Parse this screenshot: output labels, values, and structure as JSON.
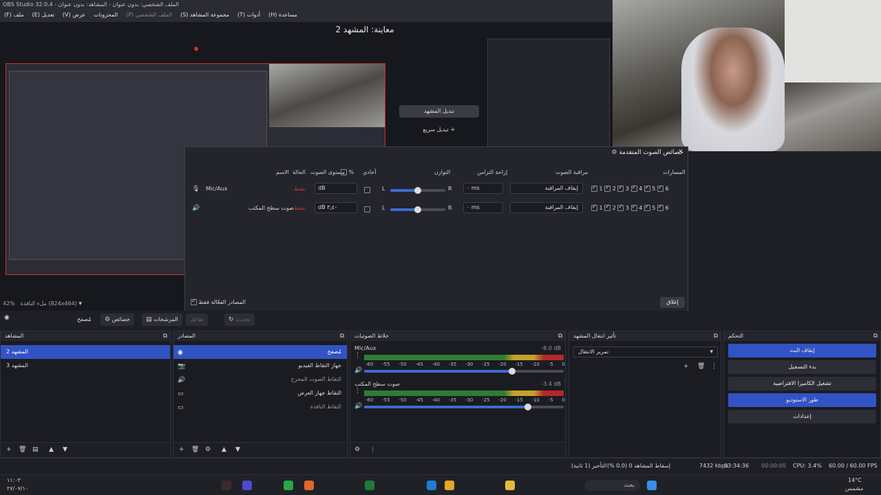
{
  "window": {
    "title": "OBS Studio 32.0.4 - الملف الشخصي: بدون عنوان - المشاهد: بدون عنوان"
  },
  "menu": [
    {
      "label": "ملف (F)"
    },
    {
      "label": "تعديل (E)"
    },
    {
      "label": "عرض (V)"
    },
    {
      "label": "المحزونات"
    },
    {
      "label": "الملف الشخصي (P)"
    },
    {
      "label": "مجموعة المشاهد (S)"
    },
    {
      "label": "أدوات (T)"
    },
    {
      "label": "مساعدة (H)"
    }
  ],
  "preview": {
    "title": "معاينة: المشهد 2",
    "zoom": "42%",
    "mode": "ملء النافذة (824x464)"
  },
  "quick_transition": {
    "swap_label": "تبديل المشهد",
    "add_label": "تبديل سريع"
  },
  "dialog": {
    "title": "خصائص الصوت المتقدمة",
    "headers": {
      "name": "الاسم",
      "status": "الحالة",
      "volume": "مستوى الصوت",
      "percent": "%",
      "mono": "أحادي",
      "balance": "التوازن",
      "sync_offset": "إزاحة التزامن",
      "monitoring": "مراقبة الصوت",
      "tracks": "المسارات"
    },
    "rows": [
      {
        "name": "Mic/Aux",
        "status": "نشط",
        "volume": "dB",
        "L": "L",
        "R": "R",
        "sync": "٠ ms",
        "monitoring": "إيقاف المراقبة",
        "tracks": [
          "1",
          "2",
          "3",
          "4",
          "5",
          "6"
        ]
      },
      {
        "name": "صوت سطح المكتب",
        "status": "نشط",
        "volume": "dB ٣٫٤-",
        "L": "L",
        "R": "R",
        "sync": "٠ ms",
        "monitoring": "إيقاف المراقبة",
        "tracks": [
          "1",
          "2",
          "3",
          "4",
          "5",
          "6"
        ]
      }
    ],
    "active_only_label": "المصادر الفعّالة فقط",
    "close_label": "إغلاق"
  },
  "toolbar": {
    "mixer_label": "مُصفح",
    "properties_label": "خصائص",
    "filters_label": "المرشحات",
    "interact_label": "تفاعل",
    "refresh_label": "تحديث"
  },
  "docks": {
    "scenes": {
      "title": "المشاهد",
      "items": [
        "المشهد 2",
        "المشهد 3"
      ]
    },
    "sources": {
      "title": "المصادر",
      "items": [
        "مُصفح",
        "جهاز التقاط الفيديو",
        "التقاط الصوت المخرج",
        "التقاط جهاز العرض",
        "التقاط النافذة"
      ]
    },
    "mixer": {
      "title": "خلاط الصوتيات",
      "channels": [
        {
          "name": "Mic/Aux",
          "db": "-8.0 dB",
          "level": 0.74
        },
        {
          "name": "صوت سطح المكتب",
          "db": "-3.4 dB",
          "level": 0.82
        }
      ],
      "scale": [
        "-60",
        "-55",
        "-50",
        "-45",
        "-40",
        "-35",
        "-30",
        "-25",
        "-20",
        "-15",
        "-10",
        "-5",
        "0"
      ]
    },
    "transitions": {
      "title": "تأثير انتقال المشهد",
      "selected": "تمرير الانتقال"
    },
    "controls": {
      "title": "التحكم",
      "stop_stream": "إيقاف البث",
      "start_record": "بدء التسجيل",
      "virtual_cam": "تشغيل الكاميرا الافتراضية",
      "studio_mode": "طور الاستوديو",
      "settings": "إعدادات"
    }
  },
  "status": {
    "dropped": "إسقاط المشاهد 0 (0.0 %)",
    "delay": "التأخير (1 ثانية)",
    "bitrate": "7432 kbps",
    "stream_time": "03:34:36",
    "rec_time": "00:00:00",
    "cpu": "CPU: 3.4%",
    "fps": "60.00 / 60.00 FPS"
  },
  "taskbar": {
    "time": "١١:٠٣",
    "date": "٢٧/٠٧/١٠",
    "weather_temp": "14°C",
    "weather_desc": "مشمس",
    "search_label": "بحث"
  },
  "colors": {
    "accent": "#3253c4",
    "red": "#d0302f",
    "bg": "#1e1f26"
  }
}
